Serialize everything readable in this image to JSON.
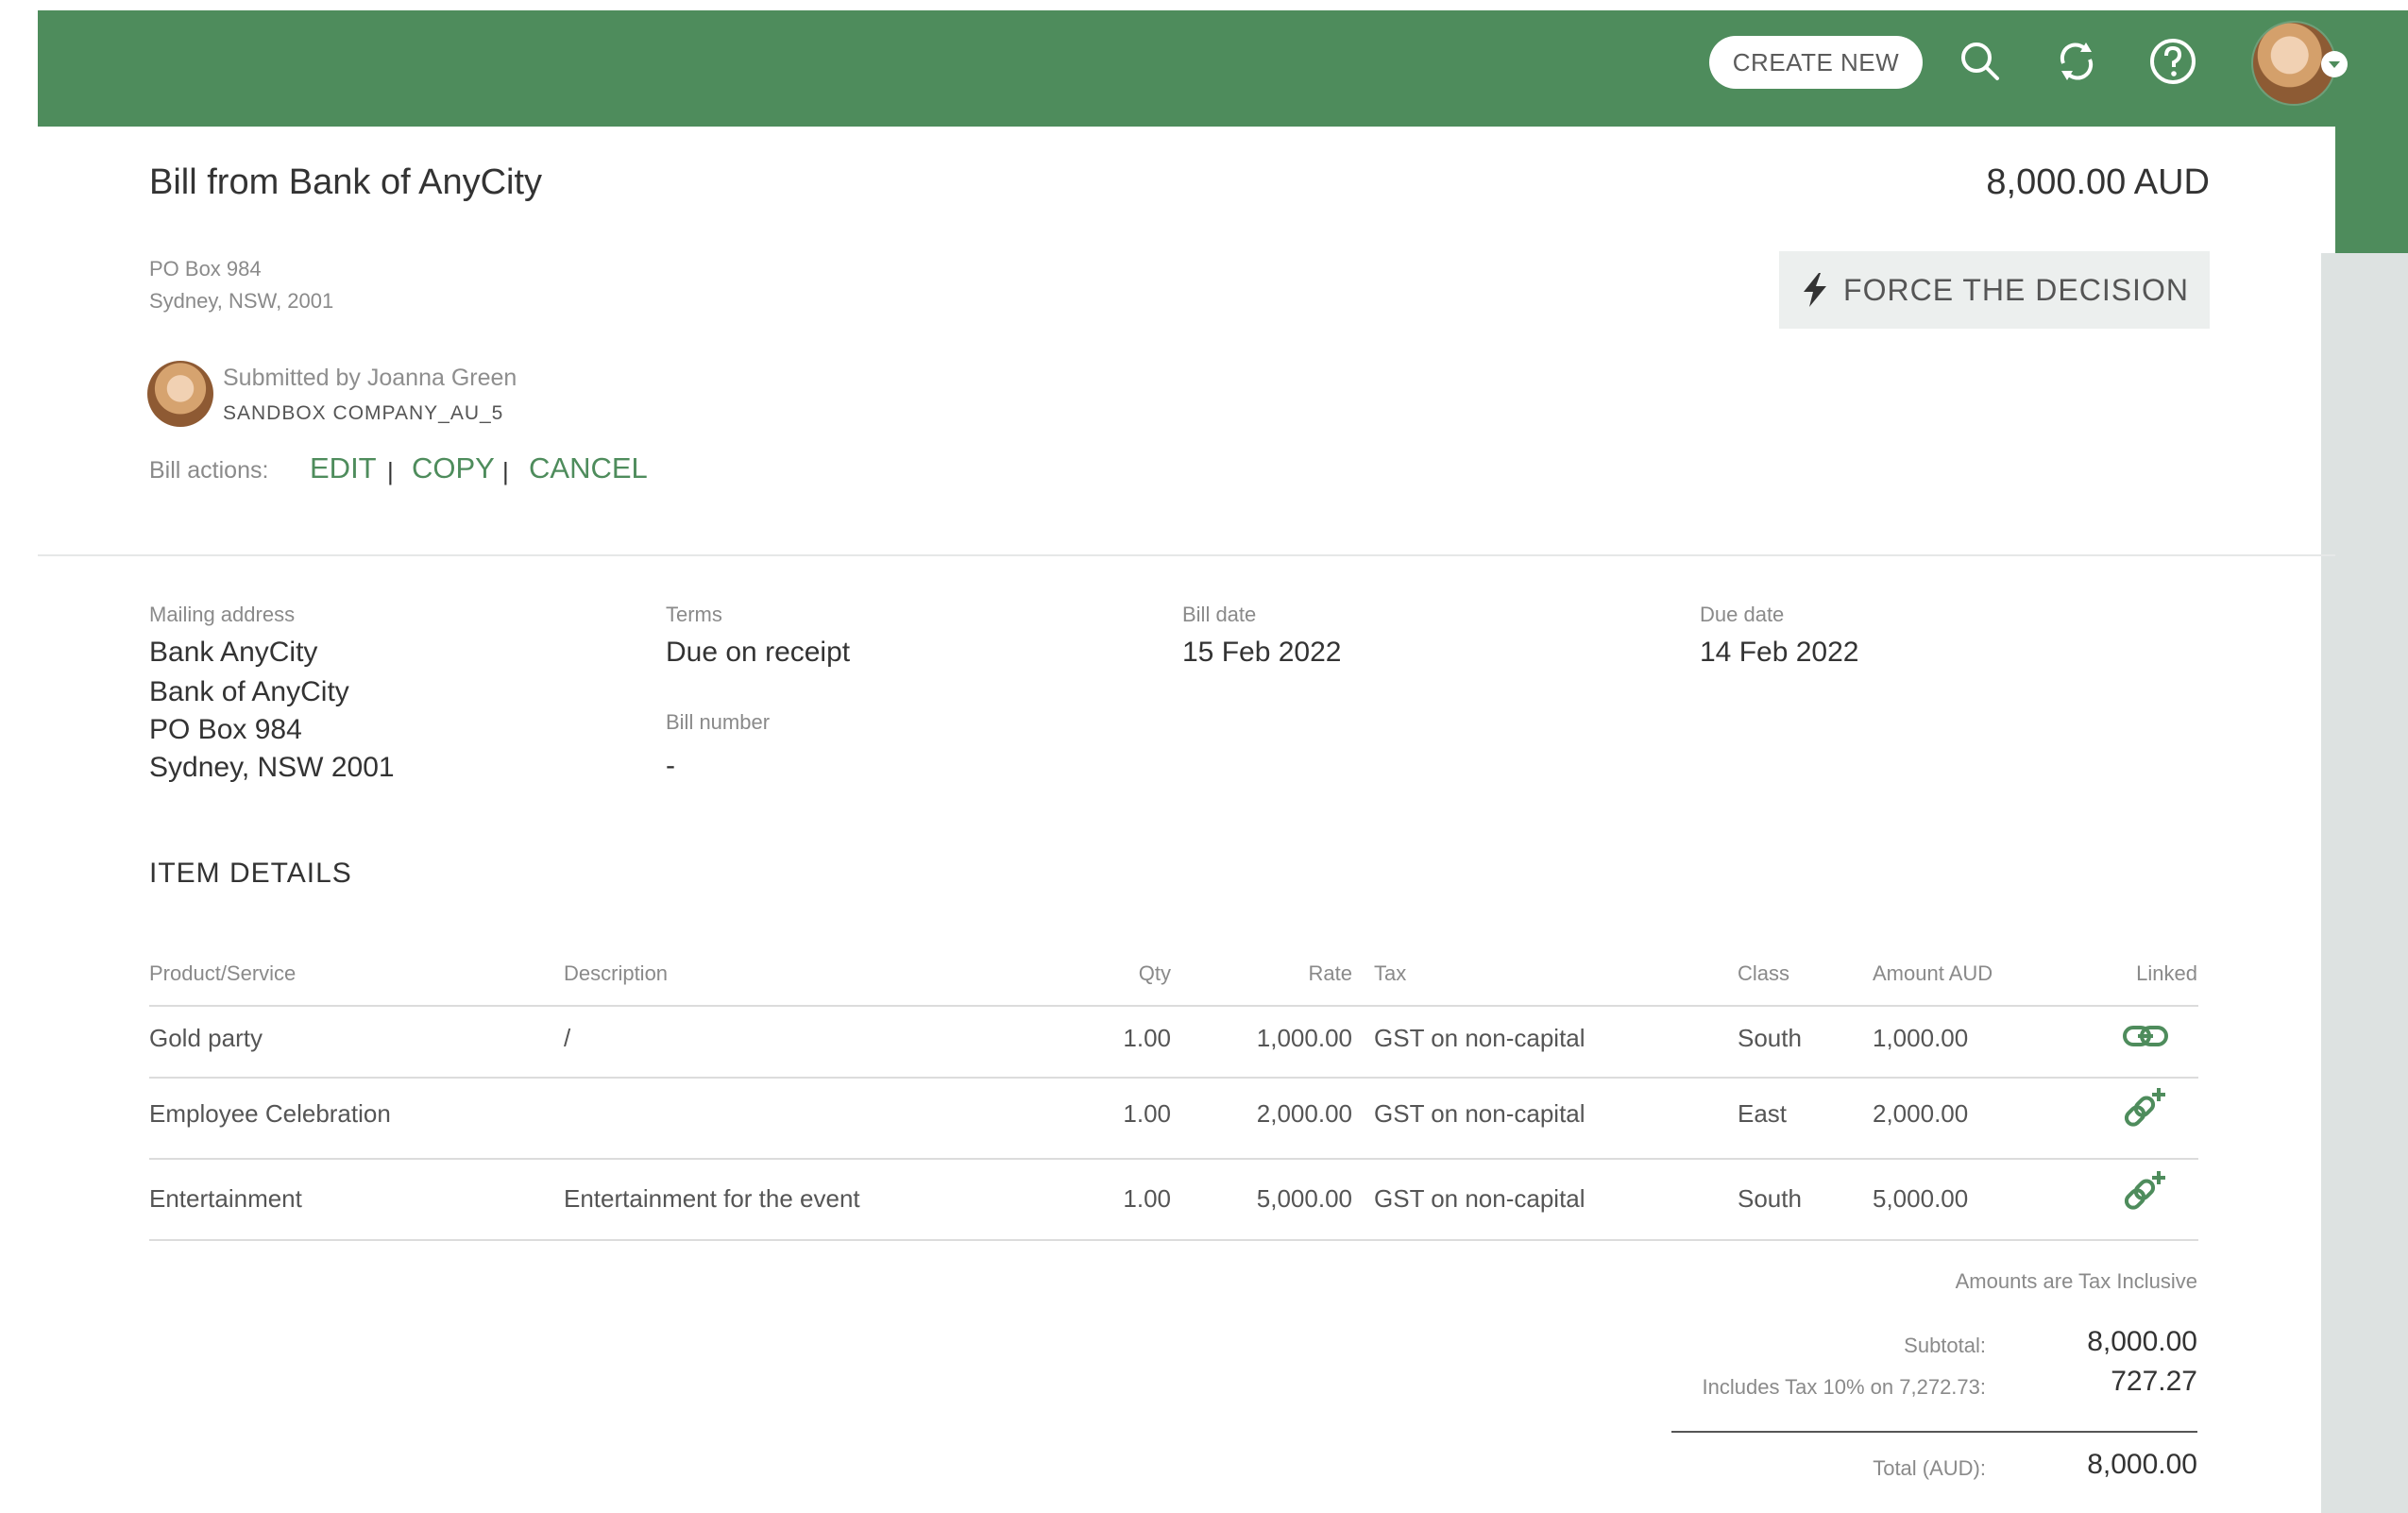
{
  "header": {
    "create_new_label": "CREATE NEW",
    "icons": [
      "search-icon",
      "refresh-icon",
      "help-icon",
      "user-avatar"
    ]
  },
  "bill": {
    "title": "Bill from Bank of AnyCity",
    "amount": "8,000.00 AUD",
    "address_line1": "PO Box 984",
    "address_line2": "Sydney, NSW, 2001",
    "force_decision_label": "FORCE THE DECISION",
    "submitted_by": "Submitted by Joanna Green",
    "company": "SANDBOX COMPANY_AU_5",
    "actions_label": "Bill actions:",
    "actions": {
      "edit": "EDIT",
      "copy": "COPY",
      "cancel": "CANCEL",
      "separator": "|"
    }
  },
  "details": {
    "mailing_address_label": "Mailing address",
    "mailing_address": [
      "Bank AnyCity",
      "Bank of AnyCity",
      "PO Box 984",
      "Sydney, NSW 2001"
    ],
    "terms_label": "Terms",
    "terms": "Due on receipt",
    "bill_number_label": "Bill number",
    "bill_number": "-",
    "bill_date_label": "Bill date",
    "bill_date": "15 Feb 2022",
    "due_date_label": "Due date",
    "due_date": "14 Feb 2022"
  },
  "items": {
    "section_title": "ITEM DETAILS",
    "columns": {
      "product": "Product/Service",
      "description": "Description",
      "qty": "Qty",
      "rate": "Rate",
      "tax": "Tax",
      "class": "Class",
      "amount": "Amount AUD",
      "linked": "Linked"
    },
    "rows": [
      {
        "product": "Gold party",
        "description": "/",
        "qty": "1.00",
        "rate": "1,000.00",
        "tax": "GST on non-capital",
        "class": "South",
        "amount": "1,000.00",
        "linked_icon": "link-icon"
      },
      {
        "product": "Employee Celebration",
        "description": "",
        "qty": "1.00",
        "rate": "2,000.00",
        "tax": "GST on non-capital",
        "class": "East",
        "amount": "2,000.00",
        "linked_icon": "add-link-icon"
      },
      {
        "product": "Entertainment",
        "description": "Entertainment for the event",
        "qty": "1.00",
        "rate": "5,000.00",
        "tax": "GST on non-capital",
        "class": "South",
        "amount": "5,000.00",
        "linked_icon": "add-link-icon"
      }
    ]
  },
  "totals": {
    "note": "Amounts are Tax Inclusive",
    "subtotal_label": "Subtotal:",
    "subtotal": "8,000.00",
    "tax_label": "Includes Tax 10% on 7,272.73:",
    "tax": "727.27",
    "total_label": "Total (AUD):",
    "total": "8,000.00"
  },
  "colors": {
    "brand_green": "#4e8c5c",
    "link_green": "#4e8c5c"
  }
}
